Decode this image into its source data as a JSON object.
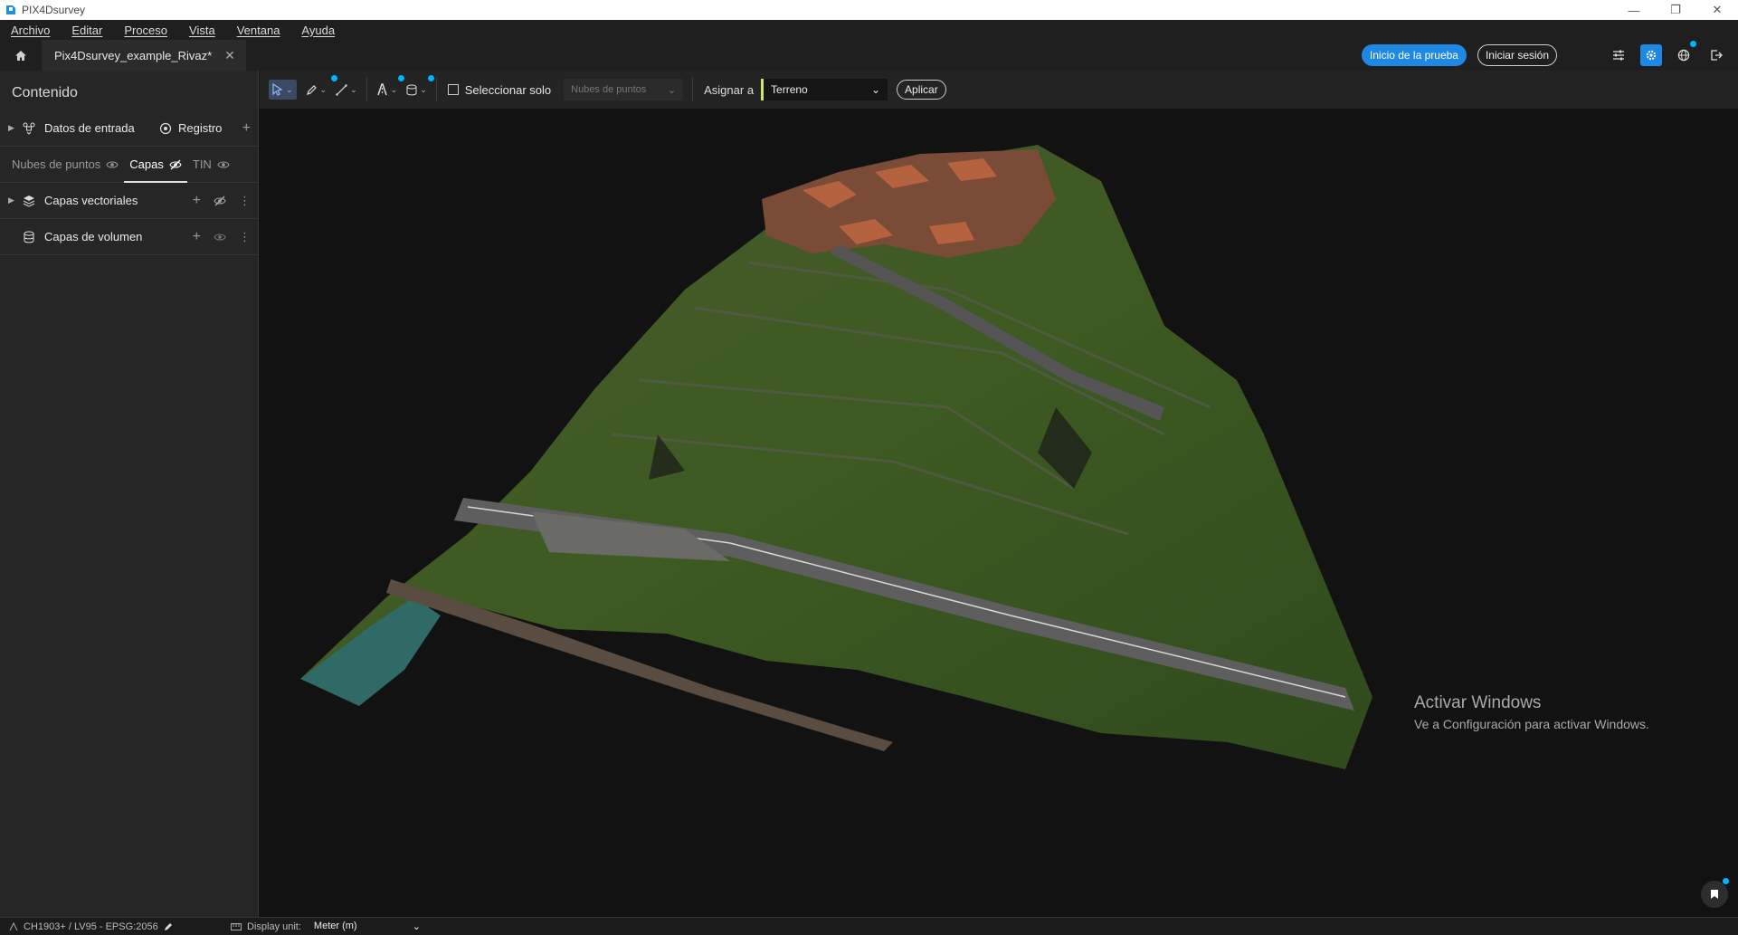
{
  "window": {
    "title": "PIX4Dsurvey",
    "controls": [
      "—",
      "❐",
      "✕"
    ]
  },
  "menu": [
    {
      "label": "Archivo"
    },
    {
      "label": "Editar"
    },
    {
      "label": "Proceso"
    },
    {
      "label": "Vista"
    },
    {
      "label": "Ventana"
    },
    {
      "label": "Ayuda"
    }
  ],
  "tab": {
    "label": "Pix4Dsurvey_example_Rivaz*",
    "close": "✕"
  },
  "header": {
    "trial_label": "Inicio de la prueba",
    "login_label": "Iniciar sesión"
  },
  "sidebar": {
    "title": "Contenido",
    "input_data": "Datos de entrada",
    "registration": "Registro",
    "subtabs": [
      {
        "label": "Nubes de puntos"
      },
      {
        "label": "Capas"
      },
      {
        "label": "TIN"
      }
    ],
    "vector_layers": "Capas vectoriales",
    "volume_layers": "Capas de volumen"
  },
  "toolbar": {
    "select_only": "Seleccionar solo",
    "point_cloud_dropdown": "Nubes de puntos",
    "assign_label": "Asignar a",
    "class_value": "Terreno",
    "class_color": "#c7e86b",
    "apply_label": "Aplicar"
  },
  "viewport": {
    "watermark_title": "Activar Windows",
    "watermark_subtitle": "Ve a Configuración para activar Windows."
  },
  "status": {
    "crs": "CH1903+ / LV95 - EPSG:2056",
    "display_unit_label": "Display unit:",
    "display_unit_value": "Meter (m)"
  },
  "colors": {
    "accent": "#1e88e5",
    "notification_dot": "#00b4ff"
  }
}
